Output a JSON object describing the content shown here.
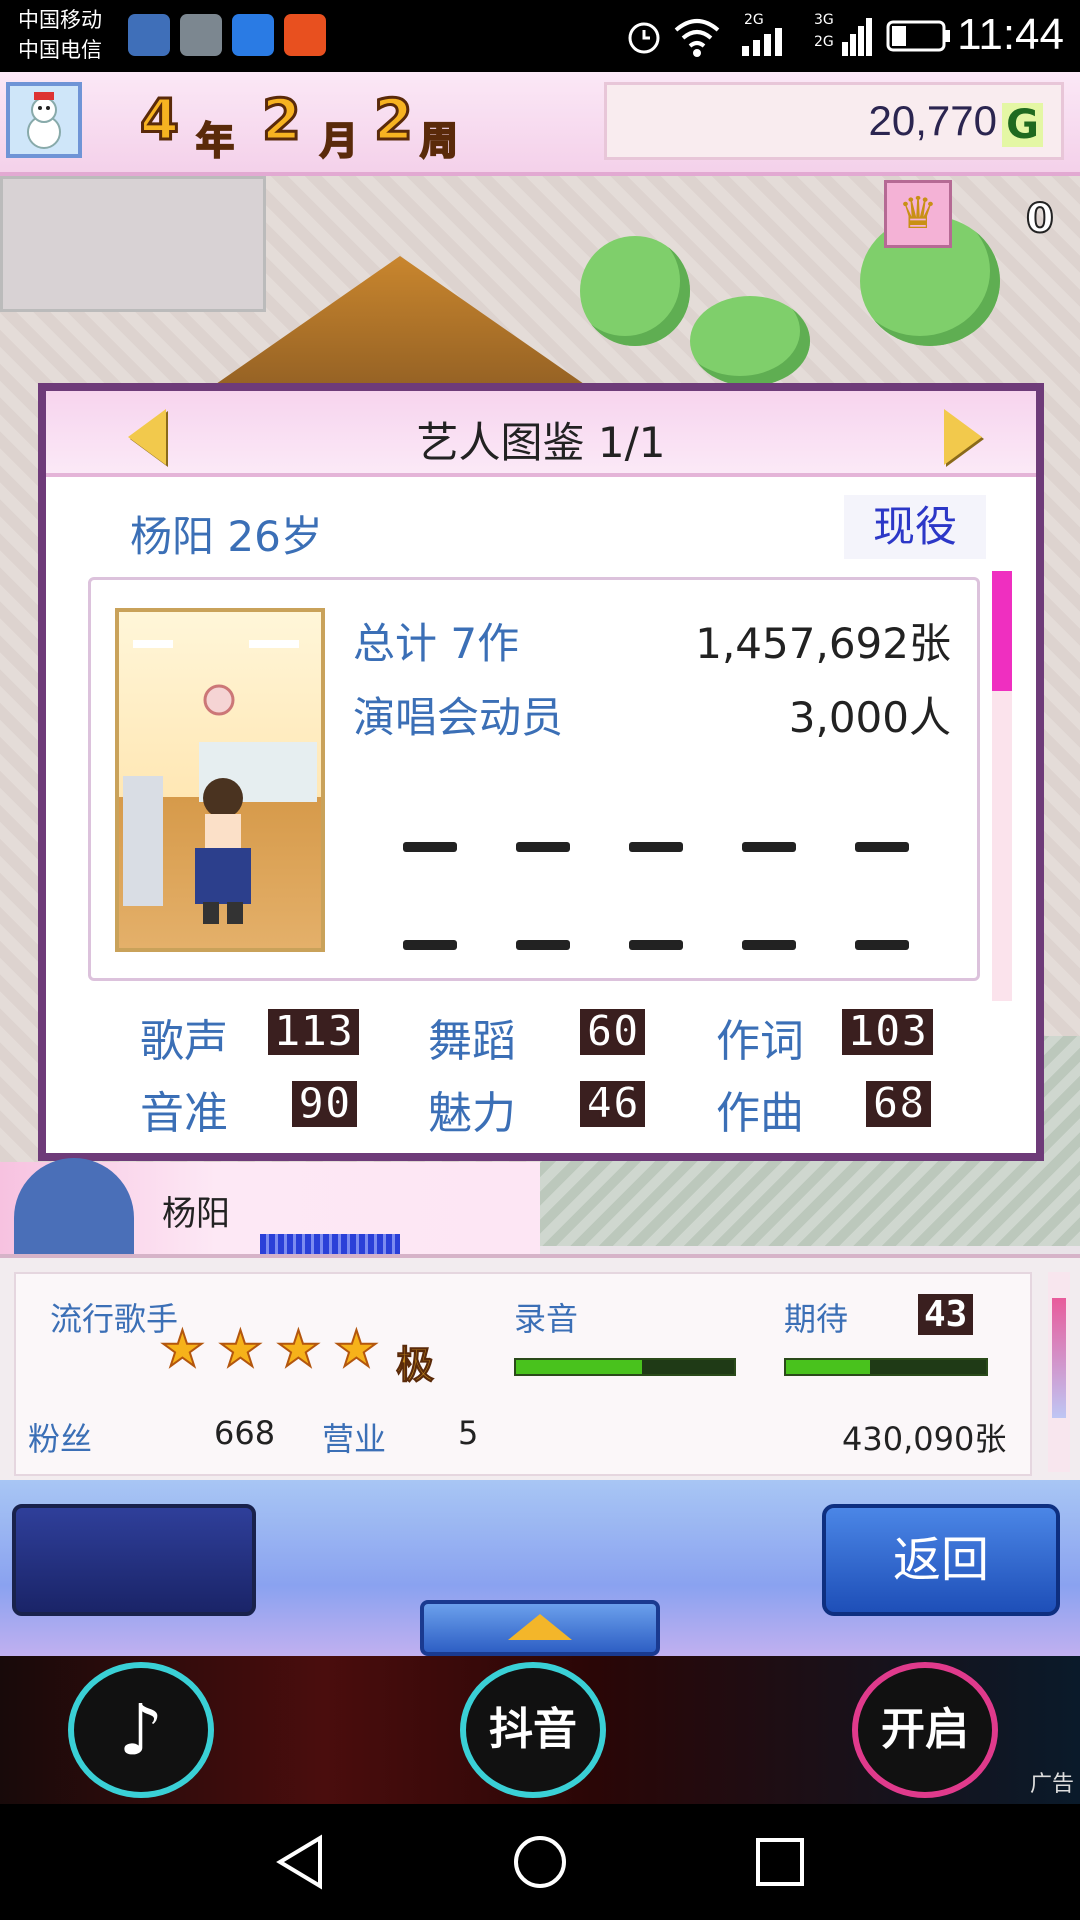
{
  "status_bar": {
    "carrier_1": "中国移动",
    "carrier_2": "中国电信",
    "net_1": "2G",
    "net_2": "3G",
    "net_3": "2G",
    "time": "11:44"
  },
  "top_bar": {
    "year": "4",
    "year_unit": "年",
    "month": "2",
    "month_unit": "月",
    "week": "2",
    "week_unit": "周",
    "money": "20,770",
    "currency": "G",
    "trophy_count": "0"
  },
  "dialog": {
    "title": "艺人图鉴 1/1",
    "artist_heading": "杨阳 26岁",
    "status": "现役",
    "total_label": "总计 7作",
    "total_value": "1,457,692张",
    "concert_label": "演唱会动员",
    "concert_value": "3,000人",
    "stats": [
      {
        "label": "歌声",
        "value": "113"
      },
      {
        "label": "舞蹈",
        "value": "60"
      },
      {
        "label": "作词",
        "value": "103"
      },
      {
        "label": "音准",
        "value": "90"
      },
      {
        "label": "魅力",
        "value": "46"
      },
      {
        "label": "作曲",
        "value": "68"
      }
    ]
  },
  "name_strip": {
    "name": "杨阳"
  },
  "info_panel": {
    "genre": "流行歌手",
    "stars": 4,
    "rank_badge": "极",
    "recording_label": "录音",
    "recording_progress": 0.58,
    "expectation_label": "期待",
    "expectation_value": "43",
    "expectation_progress": 0.42,
    "fans_label": "粉丝",
    "fans_value": "668",
    "business_label": "营业",
    "business_value": "5",
    "sales_value": "430,090张"
  },
  "actions": {
    "back_label": "返回"
  },
  "ad": {
    "center_label": "抖音",
    "right_label": "开启",
    "tag": "广告"
  },
  "colors": {
    "dialog_border": "#6e3b79",
    "label_blue": "#3b6fb6",
    "status_blue": "#2c37c7",
    "scroll_pink": "#ef2fc0",
    "gauge_green": "#49c21d"
  }
}
